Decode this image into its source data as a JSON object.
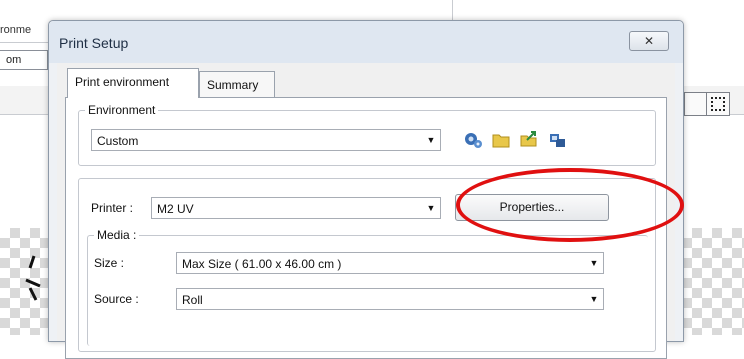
{
  "background": {
    "label_top": "ronme",
    "field_value": "om"
  },
  "dialog": {
    "title": "Print Setup",
    "close_glyph": "✕"
  },
  "tabs": [
    {
      "label": "Print environment",
      "active": true
    },
    {
      "label": "Summary",
      "active": false
    }
  ],
  "environment": {
    "legend": "Environment",
    "selected": "Custom",
    "icons": [
      "settings-icon",
      "folder-icon",
      "open-folder-icon",
      "network-icon"
    ]
  },
  "printer": {
    "label": "Printer :",
    "value": "M2 UV",
    "properties_label": "Properties..."
  },
  "media": {
    "legend": "Media :",
    "size_label": "Size :",
    "size_value": "Max Size ( 61.00 x 46.00 cm )",
    "source_label": "Source :",
    "source_value": "Roll"
  },
  "colors": {
    "annotation": "#e01010",
    "titlebar": "#dfe7f1"
  }
}
